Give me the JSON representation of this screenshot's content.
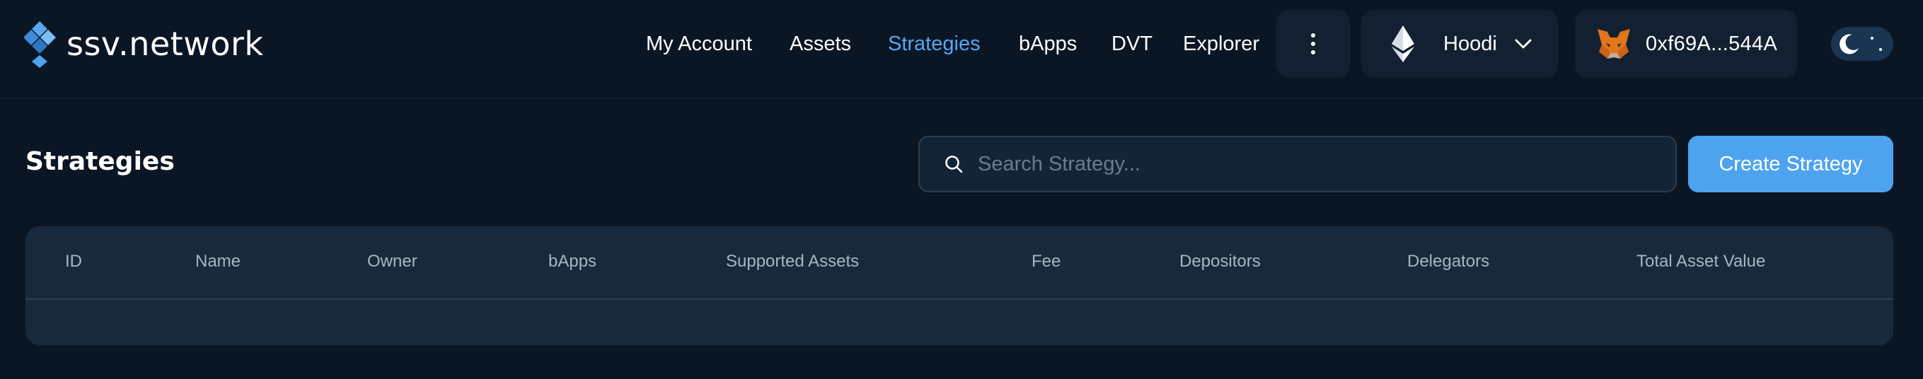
{
  "brand": {
    "name": "ssv.network"
  },
  "nav": {
    "items": [
      {
        "label": "My Account",
        "active": false
      },
      {
        "label": "Assets",
        "active": false
      },
      {
        "label": "Strategies",
        "active": true
      },
      {
        "label": "bApps",
        "active": false
      },
      {
        "label": "DVT",
        "active": false
      },
      {
        "label": "Explorer",
        "active": false
      }
    ]
  },
  "network": {
    "label": "Hoodi",
    "icon": "ethereum-icon"
  },
  "wallet": {
    "address": "0xf69A...544A",
    "icon": "metamask-fox-icon"
  },
  "theme": {
    "mode": "dark",
    "icon": "moon-icon"
  },
  "page": {
    "title": "Strategies"
  },
  "search": {
    "placeholder": "Search Strategy...",
    "value": ""
  },
  "actions": {
    "create_label": "Create Strategy"
  },
  "table": {
    "columns": [
      "ID",
      "Name",
      "Owner",
      "bApps",
      "Supported Assets",
      "Fee",
      "Depositors",
      "Delegators",
      "Total Asset Value"
    ],
    "rows": []
  },
  "colors": {
    "background": "#0b1625",
    "surface": "#122032",
    "accent": "#4ea3ef",
    "active_link": "#5aa7f0"
  }
}
